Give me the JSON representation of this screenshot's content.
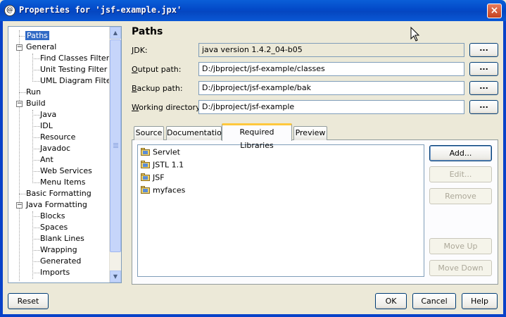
{
  "window": {
    "title": "Properties for 'jsf-example.jpx'",
    "icon": "app-icon",
    "close_icon": "×"
  },
  "tree": {
    "items": [
      {
        "label": "Paths",
        "selected": true
      },
      {
        "label": "General",
        "expander": "−"
      },
      {
        "label": "Find Classes Filter"
      },
      {
        "label": "Unit Testing Filter"
      },
      {
        "label": "UML Diagram Filter"
      },
      {
        "label": "Run"
      },
      {
        "label": "Build",
        "expander": "−"
      },
      {
        "label": "Java"
      },
      {
        "label": "IDL"
      },
      {
        "label": "Resource"
      },
      {
        "label": "Javadoc"
      },
      {
        "label": "Ant"
      },
      {
        "label": "Web Services"
      },
      {
        "label": "Menu Items"
      },
      {
        "label": "Basic Formatting"
      },
      {
        "label": "Java Formatting",
        "expander": "−"
      },
      {
        "label": "Blocks"
      },
      {
        "label": "Spaces"
      },
      {
        "label": "Blank Lines"
      },
      {
        "label": "Wrapping"
      },
      {
        "label": "Generated"
      },
      {
        "label": "Imports"
      }
    ]
  },
  "main": {
    "heading": "Paths",
    "fields": {
      "jdk": {
        "label_mnemonic": "J",
        "label_rest": "DK:",
        "value": "java version 1.4.2_04-b05"
      },
      "output": {
        "label_mnemonic": "O",
        "label_rest": "utput path:",
        "value": "D:/jbproject/jsf-example/classes"
      },
      "backup": {
        "label_mnemonic": "B",
        "label_rest": "ackup path:",
        "value": "D:/jbproject/jsf-example/bak"
      },
      "working": {
        "label_mnemonic": "W",
        "label_rest": "orking directory:",
        "value": "D:/jbproject/jsf-example"
      }
    },
    "browse_label": "...",
    "tabs": [
      "Source",
      "Documentation",
      "Required Libraries",
      "Preview"
    ],
    "active_tab": "Required Libraries",
    "libraries": [
      "Servlet",
      "JSTL 1.1",
      "JSF",
      "myfaces"
    ],
    "buttons": {
      "add": "Add...",
      "edit": "Edit...",
      "remove": "Remove",
      "move_up": "Move Up",
      "move_down": "Move Down"
    }
  },
  "footer": {
    "reset": "Reset",
    "ok": "OK",
    "cancel": "Cancel",
    "help": "Help"
  },
  "colors": {
    "titlebar": "#0A5FD8",
    "selection": "#316AC5",
    "tab_highlight": "#FFC83C",
    "dialog_bg": "#ECE9D8"
  }
}
